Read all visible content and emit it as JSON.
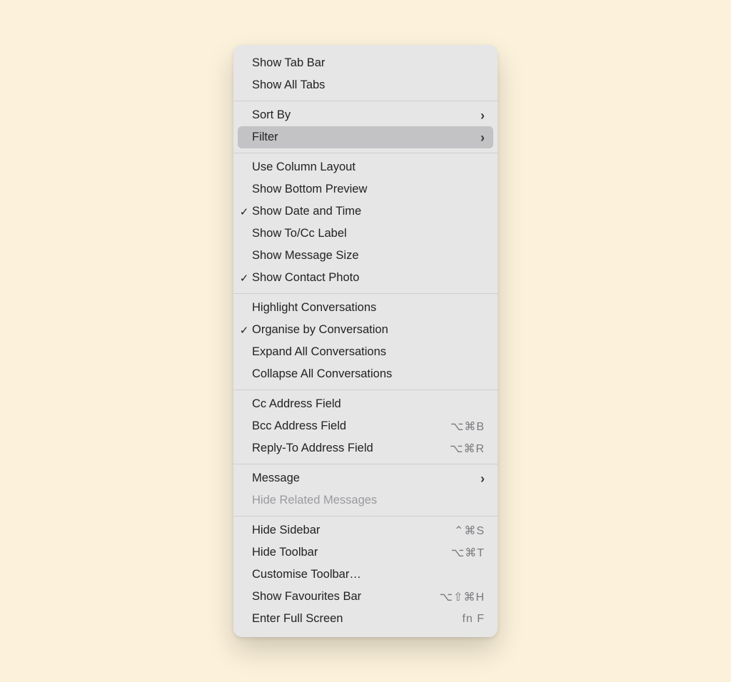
{
  "menu": {
    "groups": [
      [
        {
          "id": "show-tab-bar",
          "label": "Show Tab Bar"
        },
        {
          "id": "show-all-tabs",
          "label": "Show All Tabs"
        }
      ],
      [
        {
          "id": "sort-by",
          "label": "Sort By",
          "submenu": true
        },
        {
          "id": "filter",
          "label": "Filter",
          "submenu": true,
          "highlighted": true
        }
      ],
      [
        {
          "id": "use-column-layout",
          "label": "Use Column Layout"
        },
        {
          "id": "show-bottom-preview",
          "label": "Show Bottom Preview"
        },
        {
          "id": "show-date-time",
          "label": "Show Date and Time",
          "checked": true
        },
        {
          "id": "show-to-cc-label",
          "label": "Show To/Cc Label"
        },
        {
          "id": "show-message-size",
          "label": "Show Message Size"
        },
        {
          "id": "show-contact-photo",
          "label": "Show Contact Photo",
          "checked": true
        }
      ],
      [
        {
          "id": "highlight-conversations",
          "label": "Highlight Conversations"
        },
        {
          "id": "organise-by-conversation",
          "label": "Organise by Conversation",
          "checked": true
        },
        {
          "id": "expand-all-conversations",
          "label": "Expand All Conversations"
        },
        {
          "id": "collapse-all-conversations",
          "label": "Collapse All Conversations"
        }
      ],
      [
        {
          "id": "cc-address-field",
          "label": "Cc Address Field"
        },
        {
          "id": "bcc-address-field",
          "label": "Bcc Address Field",
          "shortcut": "⌥⌘B"
        },
        {
          "id": "reply-to-address-field",
          "label": "Reply-To Address Field",
          "shortcut": "⌥⌘R"
        }
      ],
      [
        {
          "id": "message",
          "label": "Message",
          "submenu": true
        },
        {
          "id": "hide-related-messages",
          "label": "Hide Related Messages",
          "disabled": true
        }
      ],
      [
        {
          "id": "hide-sidebar",
          "label": "Hide Sidebar",
          "shortcut": "⌃⌘S"
        },
        {
          "id": "hide-toolbar",
          "label": "Hide Toolbar",
          "shortcut": "⌥⌘T"
        },
        {
          "id": "customise-toolbar",
          "label": "Customise Toolbar…"
        },
        {
          "id": "show-favourites-bar",
          "label": "Show Favourites Bar",
          "shortcut": "⌥⇧⌘H"
        },
        {
          "id": "enter-full-screen",
          "label": "Enter Full Screen",
          "shortcut": "fn F"
        }
      ]
    ]
  }
}
